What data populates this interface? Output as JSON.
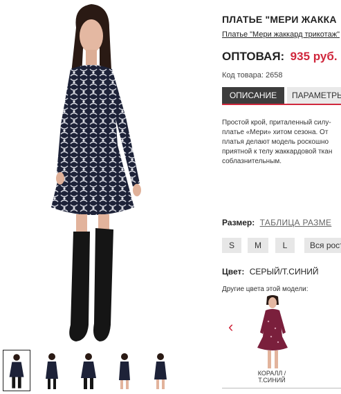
{
  "product": {
    "title": "ПЛАТЬЕ \"МЕРИ ЖАККА",
    "subtitle": "Платье \"Мери жаккард трикотаж\"",
    "price_label": "ОПТОВАЯ:",
    "price_value": "935 руб.",
    "sku": "Код товара: 2658"
  },
  "tabs": [
    {
      "label": "ОПИСАНИЕ",
      "active": true
    },
    {
      "label": "ПАРАМЕТРЫ",
      "active": false
    }
  ],
  "description": {
    "lines": [
      "Простой крой, приталенный силу-",
      "платье «Мери» хитом сезона. От",
      "платья делают модель роскошно",
      "приятной к телу жаккардовой ткан",
      "соблазнительным."
    ]
  },
  "size": {
    "label": "Размер:",
    "table_link": "ТАБЛИЦА РАЗМЕ",
    "options": [
      "S",
      "M",
      "L",
      "Вся рост"
    ]
  },
  "color": {
    "label": "Цвет:",
    "value": "СЕРЫЙ/Т.СИНИЙ",
    "other_label": "Другие цвета этой модели:",
    "variant_label_1": "КОРАЛЛ /",
    "variant_label_2": "Т.СИНИЙ"
  },
  "icons": {
    "prev_arrow": "chevron-left-icon"
  },
  "colors": {
    "accent": "#d0273c",
    "active_tab": "#3d3d3d",
    "button_bg": "#e7e7e7",
    "dress_main": "#1d2238",
    "dress_variant": "#7a1f3c"
  }
}
